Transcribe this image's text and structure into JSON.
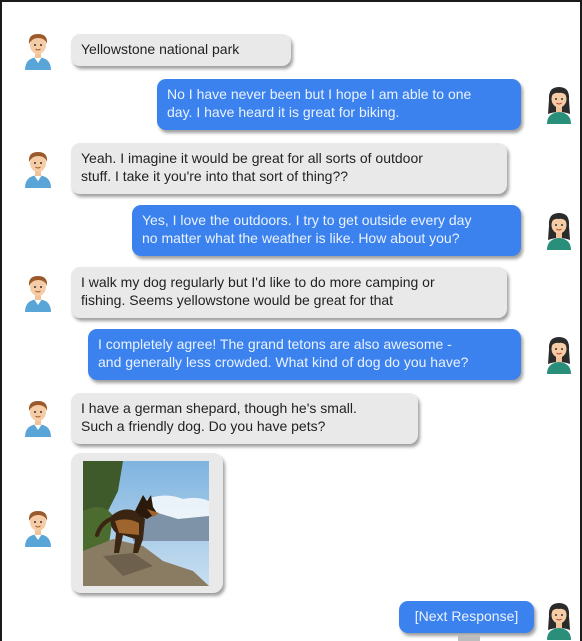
{
  "conversation": {
    "messages": [
      {
        "sender": "user",
        "text": "Yellowstone national park"
      },
      {
        "sender": "bot",
        "text": "No I have never been but I hope I am able to one\nday. I have heard it is great for biking."
      },
      {
        "sender": "user",
        "text": "Yeah. I imagine it would be great for all sorts of outdoor\nstuff. I take it you're into that sort of thing??"
      },
      {
        "sender": "bot",
        "text": "Yes, I love the outdoors. I try to get outside every day\nno matter what the weather is like. How about you?"
      },
      {
        "sender": "user",
        "text": "I walk my dog regularly but I'd like to do more camping or\nfishing. Seems yellowstone would be great for that"
      },
      {
        "sender": "bot",
        "text": "I completely agree! The grand tetons are also awesome -\nand generally less crowded. What kind of dog do you have?"
      },
      {
        "sender": "user",
        "text": "I have a german shepard, though he's small.\nSuch a friendly dog. Do you have pets?"
      },
      {
        "sender": "user",
        "type": "image",
        "image": "german-shepherd-photo"
      }
    ],
    "next_response": "[Next Response]"
  },
  "colors": {
    "user_bubble": "#e9e9e9",
    "bot_bubble": "#3b82ee",
    "bot_text": "#eaf2ff",
    "user_text": "#222222"
  },
  "icons": {
    "user_avatar": "man-avatar-icon",
    "bot_avatar": "woman-avatar-icon"
  }
}
